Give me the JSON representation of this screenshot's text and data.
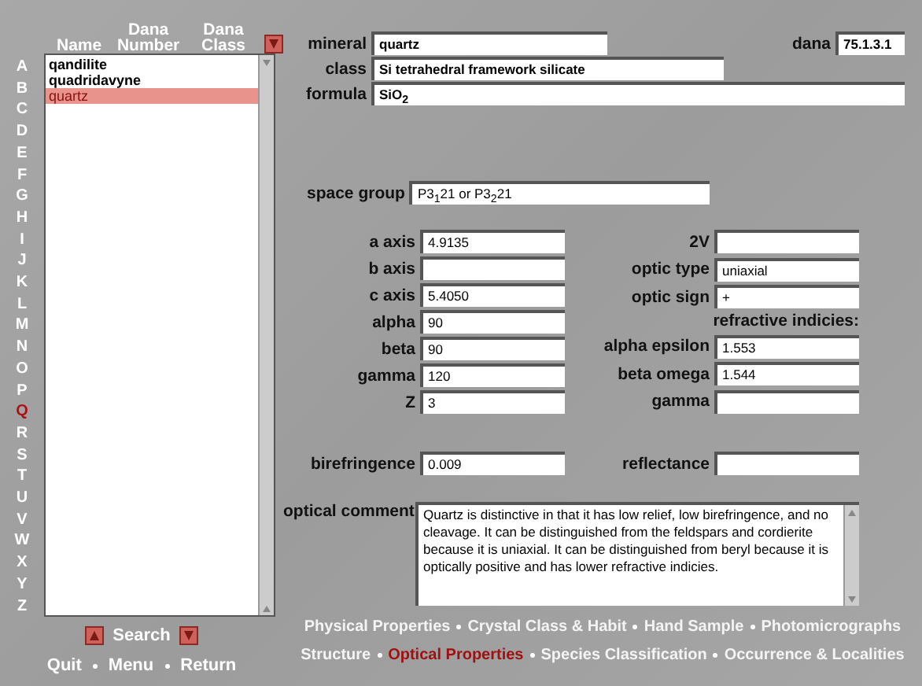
{
  "sidebar": {
    "headers": [
      "Name",
      "Dana Number",
      "Dana Class"
    ],
    "letters": [
      {
        "label": "A",
        "selected": false
      },
      {
        "label": "B",
        "selected": false
      },
      {
        "label": "C",
        "selected": false
      },
      {
        "label": "D",
        "selected": false
      },
      {
        "label": "E",
        "selected": false
      },
      {
        "label": "F",
        "selected": false
      },
      {
        "label": "G",
        "selected": false
      },
      {
        "label": "H",
        "selected": false
      },
      {
        "label": "I",
        "selected": false
      },
      {
        "label": "J",
        "selected": false
      },
      {
        "label": "K",
        "selected": false
      },
      {
        "label": "L",
        "selected": false
      },
      {
        "label": "M",
        "selected": false
      },
      {
        "label": "N",
        "selected": false
      },
      {
        "label": "O",
        "selected": false
      },
      {
        "label": "P",
        "selected": false
      },
      {
        "label": "Q",
        "selected": true
      },
      {
        "label": "R",
        "selected": false
      },
      {
        "label": "S",
        "selected": false
      },
      {
        "label": "T",
        "selected": false
      },
      {
        "label": "U",
        "selected": false
      },
      {
        "label": "V",
        "selected": false
      },
      {
        "label": "W",
        "selected": false
      },
      {
        "label": "X",
        "selected": false
      },
      {
        "label": "Y",
        "selected": false
      },
      {
        "label": "Z",
        "selected": false
      }
    ],
    "items": [
      {
        "name": "qandilite",
        "selected": false
      },
      {
        "name": "quadridavyne",
        "selected": false
      },
      {
        "name": "quartz",
        "selected": true
      }
    ],
    "search": "Search",
    "links": [
      "Quit",
      "Menu",
      "Return"
    ]
  },
  "form": {
    "mineral": {
      "label": "mineral",
      "value": "quartz"
    },
    "dana": {
      "label": "dana",
      "value": "75.1.3.1"
    },
    "class": {
      "label": "class",
      "value": "Si tetrahedral framework silicate"
    },
    "formula": {
      "label": "formula",
      "value": "SiO$_{2}$"
    },
    "space_group": {
      "label": "space group",
      "value": "P3$_{1}$21 or P3$_{2}$21"
    },
    "left_fields": [
      {
        "label": "a axis",
        "value": "4.9135"
      },
      {
        "label": "b axis"
      },
      {
        "label": "c axis",
        "value": "5.4050"
      },
      {
        "label": "alpha",
        "value": "90"
      },
      {
        "label": "beta",
        "value": "90"
      },
      {
        "label": "gamma",
        "value": "120"
      },
      {
        "label": "Z",
        "value": "3"
      }
    ],
    "right_fields": [
      {
        "kind": "field",
        "label": "2V"
      },
      {
        "kind": "field",
        "label": "optic type",
        "value": "uniaxial"
      },
      {
        "kind": "field",
        "label": "optic sign",
        "value": "+"
      },
      {
        "kind": "heading",
        "label": "refractive indicies:"
      },
      {
        "kind": "field",
        "label": "alpha epsilon",
        "value": "1.553"
      },
      {
        "kind": "field",
        "label": "beta omega",
        "value": "1.544"
      },
      {
        "kind": "field",
        "label": "gamma"
      }
    ],
    "birefringence": {
      "label": "birefringence",
      "value": "0.009"
    },
    "reflectance": {
      "label": "reflectance"
    },
    "optical_comment": {
      "label": "optical comment",
      "value": "Quartz is distinctive in that it has low relief, low birefringence, and no cleavage.  It can be distinguished from the feldspars and cordierite because it is uniaxial.  It can be distinguished from beryl because it is optically positive and has lower refractive indicies."
    }
  },
  "nav": [
    [
      {
        "label": "Physical Properties",
        "selected": false
      },
      {
        "label": "Crystal Class & Habit",
        "selected": false
      },
      {
        "label": "Hand Sample",
        "selected": false
      },
      {
        "label": "Photomicrographs",
        "selected": false
      }
    ],
    [
      {
        "label": "Structure",
        "selected": false
      },
      {
        "label": "Optical Properties",
        "selected": true
      },
      {
        "label": "Species Classification",
        "selected": false
      },
      {
        "label": "Occurrence & Localities",
        "selected": false
      }
    ]
  ]
}
